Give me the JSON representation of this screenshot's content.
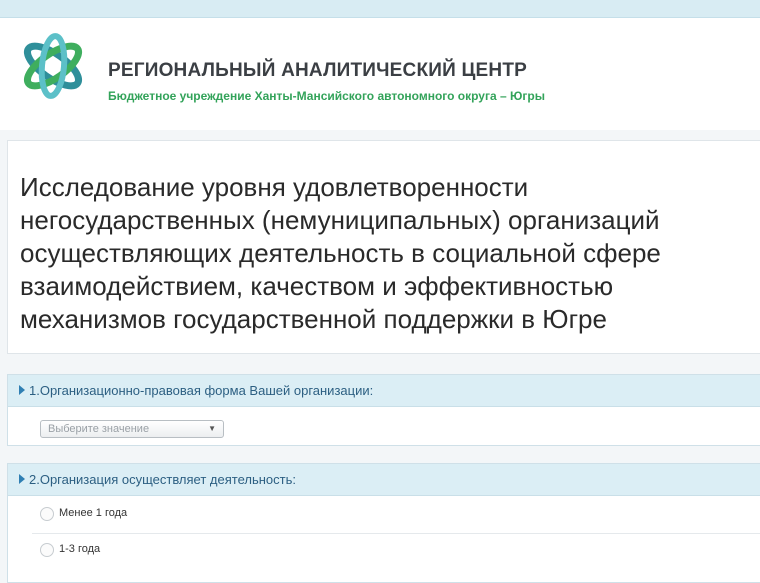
{
  "header": {
    "org_name": "РЕГИОНАЛЬНЫЙ АНАЛИТИЧЕСКИЙ ЦЕНТР",
    "org_subtitle": "Бюджетное учреждение Ханты-Мансийского автономного округа – Югры",
    "logo_icon": "atom-logo-icon"
  },
  "survey": {
    "title": "Исследование уровня удовлетворенности\nнегосударственных (немуниципальных) организаций\nосуществляющих деятельность в социальной сфере\nвзаимодействием, качеством и эффективностью\nмеханизмов государственной поддержки в Югре"
  },
  "questions": [
    {
      "label": "1.Организационно-правовая форма Вашей организации:",
      "select_placeholder": "Выберите значение"
    },
    {
      "label": "2.Организация осуществляет деятельность:",
      "options": [
        "Менее 1 года",
        "1-3 года"
      ]
    }
  ],
  "colors": {
    "accent_green": "#33a35a",
    "question_header_bg": "#dbeef5",
    "question_text": "#2c5f82"
  }
}
